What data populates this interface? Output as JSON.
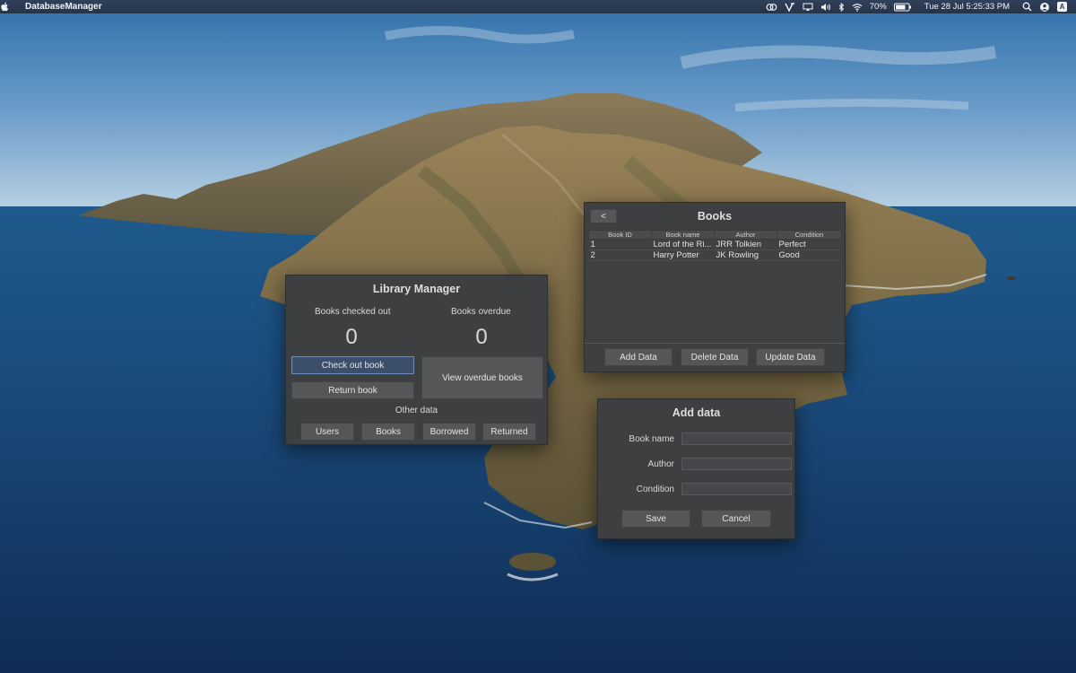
{
  "menubar": {
    "app_name": "DatabaseManager",
    "battery": "70%",
    "datetime": "Tue 28 Jul  5:25:33 PM",
    "icons": [
      "apple-icon",
      "creative-cloud-icon",
      "vpn-icon",
      "airplay-icon",
      "volume-icon",
      "bluetooth-icon",
      "wifi-icon",
      "battery-icon",
      "search-icon",
      "user-icon",
      "input-source-icon"
    ],
    "input_source": "A"
  },
  "library_manager": {
    "title": "Library Manager",
    "checked_out_label": "Books checked out",
    "overdue_label": "Books overdue",
    "checked_out_count": "0",
    "overdue_count": "0",
    "check_out_button": "Check out book",
    "return_button": "Return book",
    "view_overdue_button": "View overdue books",
    "other_data_label": "Other data",
    "users_button": "Users",
    "books_button": "Books",
    "borrowed_button": "Borrowed",
    "returned_button": "Returned"
  },
  "books_window": {
    "title": "Books",
    "back_button": "<",
    "columns": [
      "Book ID",
      "Book name",
      "Author",
      "Condition"
    ],
    "rows": [
      [
        "1",
        "Lord of the Ri...",
        "JRR Tolkien",
        "Perfect"
      ],
      [
        "2",
        "Harry Potter",
        "JK Rowling",
        "Good"
      ]
    ],
    "add_button": "Add Data",
    "delete_button": "Delete Data",
    "update_button": "Update Data"
  },
  "add_data_window": {
    "title": "Add data",
    "book_name_label": "Book name",
    "author_label": "Author",
    "condition_label": "Condition",
    "book_name_value": "",
    "author_value": "",
    "condition_value": "",
    "save_button": "Save",
    "cancel_button": "Cancel"
  },
  "colors": {
    "window_bg": "#3e3f41",
    "button_bg": "#555658",
    "focus_accent": "#6a8ec0",
    "menubar_bg": "#2b3a50"
  }
}
